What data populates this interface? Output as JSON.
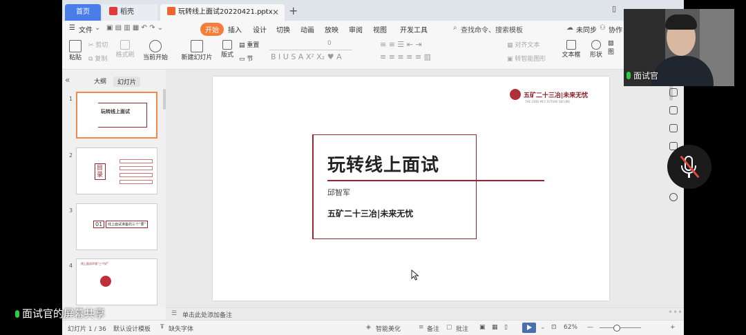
{
  "tabs": {
    "home": "首页",
    "shell": "稻壳",
    "doc": "玩转线上面试20220421.pptx"
  },
  "menu": {
    "file": "文件",
    "items": [
      "开始",
      "插入",
      "设计",
      "切换",
      "动画",
      "放映",
      "审阅",
      "视图",
      "开发工具"
    ],
    "search": "查找命令、搜索模板",
    "sync": "未同步",
    "collab": "协作"
  },
  "toolbar": {
    "cut": "剪切",
    "copy": "复制",
    "format_painter": "格式刷",
    "paste": "粘贴",
    "from_current": "当前开始",
    "new_slide": "新建幻灯片",
    "layout": "版式",
    "section": "节",
    "reset": "重置",
    "font_size": "0",
    "align_text": "对齐文本",
    "smart_shape": "转智能图形",
    "textbox": "文本框",
    "shape": "形状",
    "arrange": "图"
  },
  "left_panel": {
    "tab_outline": "大纲",
    "tab_slides": "幻灯片",
    "slide_numbers": [
      "1",
      "2",
      "3",
      "4"
    ],
    "thumb1_title": "玩转线上面试",
    "thumb2_title": "目录",
    "thumb3_num": "01",
    "thumb3_text": "线上面试准备的三个“要”",
    "thumb4_title": "线上面试环境“三个好”"
  },
  "slide": {
    "logo_text": "五矿二十三冶|未来无忧",
    "logo_sub": "THE 23RD MCC  FUTURE SECURE",
    "title": "玩转线上面试",
    "name": "邱智军",
    "org": "五矿二十三冶|未来无忧"
  },
  "notes": {
    "placeholder": "单击此处添加备注"
  },
  "status": {
    "slide_count": "幻灯片 1 / 36",
    "template": "默认设计模板",
    "missing_font": "缺失字体",
    "beautify": "智能美化",
    "notes": "备注",
    "comments": "批注",
    "zoom": "62%"
  },
  "overlay": {
    "video_label": "面试官",
    "share_label": "面试官的屏幕共享"
  },
  "colors": {
    "accent": "#f47d3a",
    "home_tab": "#4a7de8",
    "slide_red": "#9b2331"
  }
}
